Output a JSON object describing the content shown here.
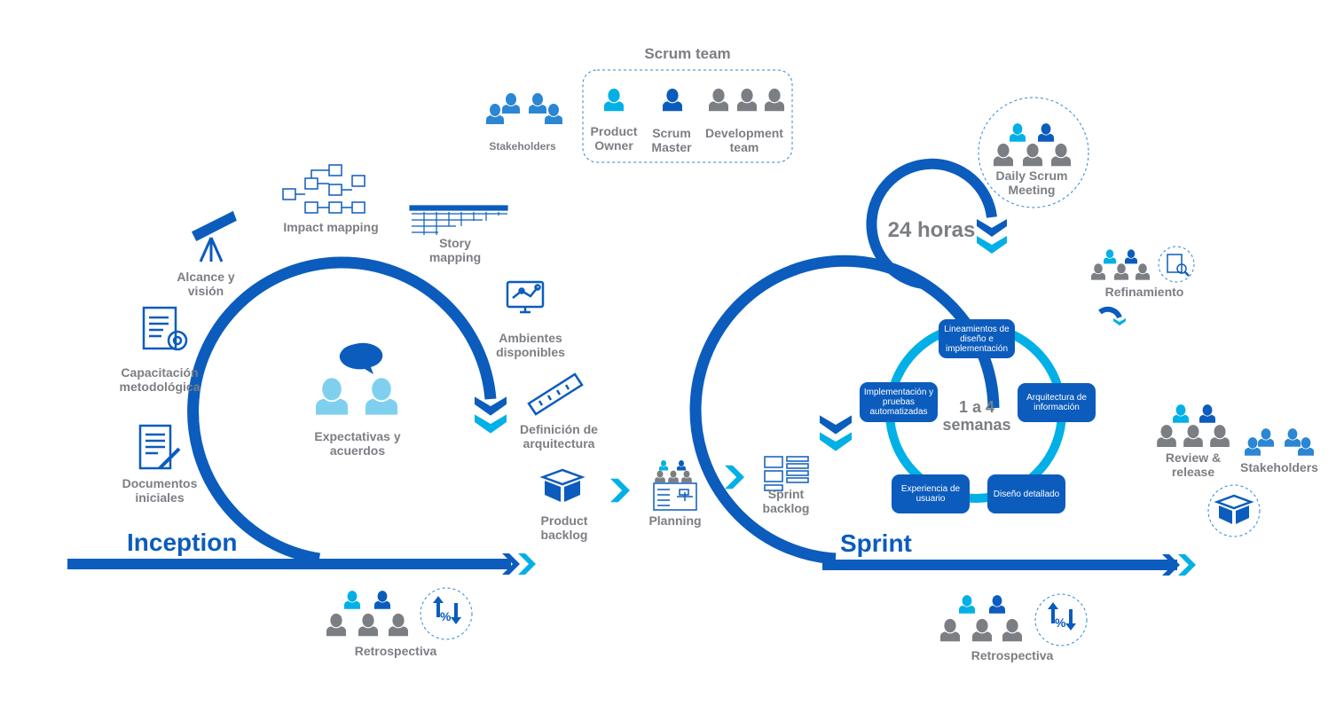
{
  "colors": {
    "dark_blue": "#0b5cbd",
    "light_blue": "#00b0e6",
    "gray": "#7b7e83",
    "mid_blue": "#2b86d4"
  },
  "scrum_team": {
    "title": "Scrum team",
    "product_owner": [
      "Product",
      "Owner"
    ],
    "scrum_master": [
      "Scrum",
      "Master"
    ],
    "development_team": [
      "Development",
      "team"
    ]
  },
  "stakeholders_top": "Stakeholders",
  "inception": {
    "title": "Inception",
    "center": [
      "Expectativas y",
      "acuerdos"
    ],
    "steps": {
      "documentos": [
        "Documentos",
        "iniciales"
      ],
      "capacitacion": [
        "Capacitación",
        "metodológica"
      ],
      "alcance": [
        "Alcance y",
        "visión"
      ],
      "impact": [
        "Impact mapping"
      ],
      "story": [
        "Story",
        "mapping"
      ],
      "ambientes": [
        "Ambientes",
        "disponibles"
      ],
      "definicion": [
        "Definición de",
        "arquitectura"
      ]
    },
    "retro": "Retrospectiva"
  },
  "flow": {
    "product_backlog": [
      "Product",
      "backlog"
    ],
    "planning": "Planning",
    "sprint_backlog": [
      "Sprint",
      "backlog"
    ]
  },
  "sprint": {
    "title": "Sprint",
    "hours": "24 horas",
    "daily": [
      "Daily Scrum",
      "Meeting"
    ],
    "duration": [
      "1 a 4",
      "semanas"
    ],
    "cycle": [
      [
        "Lineamientos de",
        "diseño e",
        "implementación"
      ],
      [
        "Arquitectura de",
        "información"
      ],
      [
        "Diseño detallado"
      ],
      [
        "Experiencia de",
        "usuario"
      ],
      [
        "Implementación y",
        "pruebas",
        "automatizadas"
      ]
    ],
    "refinamiento": "Refinamiento",
    "review": [
      "Review &",
      "release"
    ],
    "stakeholders": "Stakeholders",
    "retro": "Retrospectiva"
  }
}
